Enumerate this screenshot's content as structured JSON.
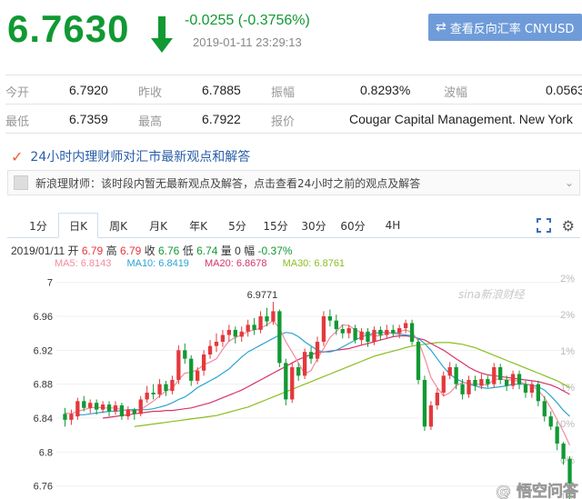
{
  "quote": {
    "price": "6.7630",
    "change": "-0.0255 (-0.3756%)",
    "timestamp": "2019-01-11 23:29:13",
    "reverse_button": "查看反向汇率 CNYUSD",
    "color_down": "#119933"
  },
  "stats": {
    "rows": [
      [
        {
          "label": "今开",
          "value": "6.7920"
        },
        {
          "label": "昨收",
          "value": "6.7885"
        },
        {
          "label": "振幅",
          "value": "0.8293%"
        },
        {
          "label": "波幅",
          "value": "0.0563"
        }
      ],
      [
        {
          "label": "最低",
          "value": "6.7359"
        },
        {
          "label": "最高",
          "value": "6.7922"
        },
        {
          "label": "报价",
          "value": "Cougar Capital Management. New York"
        }
      ]
    ]
  },
  "advice": {
    "title": "24小时内理财师对汇市最新观点和解答",
    "text": "新浪理财师：该时段内暂无最新观点及解答，点击查看24小时之前的观点及解答",
    "more": "⌄"
  },
  "tabs": [
    {
      "label": "1分",
      "active": false
    },
    {
      "label": "日K",
      "active": true
    },
    {
      "label": "周K",
      "active": false
    },
    {
      "label": "月K",
      "active": false
    },
    {
      "label": "年K",
      "active": false
    },
    {
      "label": "5分",
      "active": false
    },
    {
      "label": "15分",
      "active": false
    },
    {
      "label": "30分",
      "active": false
    },
    {
      "label": "60分",
      "active": false
    },
    {
      "label": "4H",
      "active": false
    }
  ],
  "chart_info": {
    "date": "2019/01/11",
    "open_label": "开",
    "open": "6.79",
    "high_label": "高",
    "high": "6.79",
    "close_label": "收",
    "close": "6.76",
    "low_label": "低",
    "low": "6.74",
    "vol_label": "量",
    "vol": "0",
    "amp_label": "幅",
    "amp": "-0.37%"
  },
  "ma": [
    {
      "label": "MA5: 6.8143",
      "color": "#f28b9e"
    },
    {
      "label": "MA10: 6.8419",
      "color": "#2aa4d4"
    },
    {
      "label": "MA20: 6.8678",
      "color": "#d6346a"
    },
    {
      "label": "MA30: 6.8761",
      "color": "#8bbd20"
    }
  ],
  "chart_data": {
    "type": "candlestick",
    "y_ticks": [
      "7",
      "6.96",
      "6.92",
      "6.88",
      "6.84",
      "6.8",
      "6.76"
    ],
    "ylim": [
      6.75,
      7.005
    ],
    "right_ticks": [
      "2%",
      "2%",
      "1%",
      "1%",
      "0%",
      "0%",
      "-1%"
    ],
    "max_label": "6.9771",
    "watermark": "sina新浪财经",
    "corner_watermark": "@ 悟空问答",
    "up_color": "#e4393c",
    "down_color": "#119933",
    "candles": [
      [
        6.845,
        6.838,
        6.852,
        6.83
      ],
      [
        6.838,
        6.845,
        6.85,
        6.832
      ],
      [
        6.842,
        6.86,
        6.864,
        6.838
      ],
      [
        6.86,
        6.852,
        6.866,
        6.848
      ],
      [
        6.852,
        6.858,
        6.862,
        6.846
      ],
      [
        6.858,
        6.85,
        6.862,
        6.844
      ],
      [
        6.85,
        6.856,
        6.86,
        6.846
      ],
      [
        6.856,
        6.848,
        6.86,
        6.842
      ],
      [
        6.848,
        6.855,
        6.86,
        6.844
      ],
      [
        6.855,
        6.842,
        6.858,
        6.838
      ],
      [
        6.842,
        6.85,
        6.854,
        6.838
      ],
      [
        6.85,
        6.845,
        6.852,
        6.838
      ],
      [
        6.845,
        6.862,
        6.866,
        6.842
      ],
      [
        6.862,
        6.87,
        6.878,
        6.858
      ],
      [
        6.87,
        6.868,
        6.88,
        6.862
      ],
      [
        6.868,
        6.88,
        6.886,
        6.864
      ],
      [
        6.88,
        6.872,
        6.884,
        6.866
      ],
      [
        6.872,
        6.885,
        6.89,
        6.868
      ],
      [
        6.885,
        6.92,
        6.926,
        6.88
      ],
      [
        6.92,
        6.91,
        6.928,
        6.904
      ],
      [
        6.91,
        6.884,
        6.914,
        6.878
      ],
      [
        6.884,
        6.896,
        6.9,
        6.88
      ],
      [
        6.896,
        6.915,
        6.92,
        6.89
      ],
      [
        6.915,
        6.925,
        6.932,
        6.91
      ],
      [
        6.925,
        6.93,
        6.94,
        6.918
      ],
      [
        6.93,
        6.938,
        6.944,
        6.924
      ],
      [
        6.938,
        6.944,
        6.95,
        6.93
      ],
      [
        6.944,
        6.936,
        6.948,
        6.928
      ],
      [
        6.936,
        6.942,
        6.948,
        6.93
      ],
      [
        6.942,
        6.95,
        6.956,
        6.936
      ],
      [
        6.95,
        6.944,
        6.958,
        6.938
      ],
      [
        6.944,
        6.96,
        6.966,
        6.94
      ],
      [
        6.96,
        6.954,
        6.97,
        6.948
      ],
      [
        6.954,
        6.966,
        6.977,
        6.95
      ],
      [
        6.966,
        6.905,
        6.968,
        6.9
      ],
      [
        6.905,
        6.862,
        6.91,
        6.855
      ],
      [
        6.862,
        6.9,
        6.906,
        6.858
      ],
      [
        6.9,
        6.89,
        6.905,
        6.884
      ],
      [
        6.89,
        6.918,
        6.922,
        6.886
      ],
      [
        6.918,
        6.91,
        6.924,
        6.904
      ],
      [
        6.91,
        6.93,
        6.936,
        6.906
      ],
      [
        6.93,
        6.96,
        6.966,
        6.925
      ],
      [
        6.96,
        6.955,
        6.968,
        6.948
      ],
      [
        6.955,
        6.945,
        6.962,
        6.938
      ],
      [
        6.945,
        6.94,
        6.95,
        6.934
      ],
      [
        6.94,
        6.946,
        6.95,
        6.934
      ],
      [
        6.946,
        6.932,
        6.95,
        6.928
      ],
      [
        6.932,
        6.942,
        6.946,
        6.926
      ],
      [
        6.942,
        6.93,
        6.946,
        6.924
      ],
      [
        6.93,
        6.944,
        6.948,
        6.926
      ],
      [
        6.944,
        6.938,
        6.948,
        6.932
      ],
      [
        6.938,
        6.944,
        6.95,
        6.934
      ],
      [
        6.944,
        6.94,
        6.95,
        6.936
      ],
      [
        6.94,
        6.946,
        6.95,
        6.934
      ],
      [
        6.946,
        6.952,
        6.956,
        6.94
      ],
      [
        6.952,
        6.93,
        6.956,
        6.926
      ],
      [
        6.93,
        6.885,
        6.934,
        6.88
      ],
      [
        6.885,
        6.83,
        6.89,
        6.825
      ],
      [
        6.83,
        6.855,
        6.86,
        6.826
      ],
      [
        6.855,
        6.87,
        6.875,
        6.85
      ],
      [
        6.87,
        6.89,
        6.895,
        6.866
      ],
      [
        6.89,
        6.9,
        6.906,
        6.886
      ],
      [
        6.9,
        6.88,
        6.904,
        6.874
      ],
      [
        6.88,
        6.868,
        6.886,
        6.862
      ],
      [
        6.868,
        6.885,
        6.89,
        6.864
      ],
      [
        6.885,
        6.878,
        6.89,
        6.872
      ],
      [
        6.878,
        6.886,
        6.892,
        6.874
      ],
      [
        6.886,
        6.88,
        6.89,
        6.876
      ],
      [
        6.88,
        6.9,
        6.905,
        6.876
      ],
      [
        6.9,
        6.885,
        6.904,
        6.88
      ],
      [
        6.885,
        6.878,
        6.89,
        6.872
      ],
      [
        6.878,
        6.892,
        6.896,
        6.874
      ],
      [
        6.892,
        6.88,
        6.896,
        6.874
      ],
      [
        6.88,
        6.87,
        6.884,
        6.864
      ],
      [
        6.87,
        6.88,
        6.884,
        6.864
      ],
      [
        6.88,
        6.86,
        6.884,
        6.854
      ],
      [
        6.86,
        6.842,
        6.866,
        6.836
      ],
      [
        6.842,
        6.83,
        6.848,
        6.826
      ],
      [
        6.83,
        6.81,
        6.836,
        6.802
      ],
      [
        6.81,
        6.792,
        6.812,
        6.785
      ],
      [
        6.792,
        6.763,
        6.795,
        6.742
      ]
    ],
    "ma5": [
      6.846,
      6.845,
      6.848,
      6.85,
      6.852,
      6.853,
      6.852,
      6.852,
      6.852,
      6.85,
      6.849,
      6.848,
      6.85,
      6.855,
      6.86,
      6.866,
      6.872,
      6.875,
      6.885,
      6.893,
      6.894,
      6.897,
      6.903,
      6.906,
      6.91,
      6.921,
      6.931,
      6.935,
      6.938,
      6.942,
      6.944,
      6.946,
      6.95,
      6.955,
      6.946,
      6.93,
      6.918,
      6.905,
      6.892,
      6.896,
      6.91,
      6.922,
      6.935,
      6.942,
      6.95,
      6.949,
      6.944,
      6.941,
      6.938,
      6.937,
      6.937,
      6.94,
      6.94,
      6.942,
      6.944,
      6.941,
      6.931,
      6.911,
      6.888,
      6.876,
      6.866,
      6.87,
      6.878,
      6.882,
      6.881,
      6.88,
      6.88,
      6.879,
      6.886,
      6.886,
      6.885,
      6.885,
      6.883,
      6.88,
      6.878,
      6.873,
      6.864,
      6.852,
      6.838,
      6.824,
      6.808
    ],
    "ma10": [
      6.844,
      6.844,
      6.845,
      6.846,
      6.847,
      6.848,
      6.848,
      6.849,
      6.85,
      6.85,
      6.85,
      6.85,
      6.851,
      6.853,
      6.855,
      6.858,
      6.862,
      6.865,
      6.87,
      6.876,
      6.88,
      6.884,
      6.888,
      6.893,
      6.898,
      6.905,
      6.912,
      6.918,
      6.922,
      6.926,
      6.93,
      6.934,
      6.938,
      6.941,
      6.94,
      6.936,
      6.93,
      6.925,
      6.92,
      6.918,
      6.918,
      6.92,
      6.924,
      6.928,
      6.932,
      6.936,
      6.938,
      6.94,
      6.941,
      6.941,
      6.94,
      6.939,
      6.938,
      6.937,
      6.934,
      6.928,
      6.92,
      6.91,
      6.9,
      6.892,
      6.886,
      6.883,
      6.88,
      6.878,
      6.876,
      6.875,
      6.876,
      6.877,
      6.878,
      6.88,
      6.88,
      6.88,
      6.879,
      6.877,
      6.873,
      6.866,
      6.858,
      6.849,
      6.842
    ],
    "ma20": [
      6.84,
      6.841,
      6.842,
      6.843,
      6.844,
      6.845,
      6.846,
      6.847,
      6.848,
      6.848,
      6.849,
      6.849,
      6.85,
      6.851,
      6.852,
      6.854,
      6.856,
      6.858,
      6.861,
      6.864,
      6.867,
      6.87,
      6.873,
      6.877,
      6.881,
      6.885,
      6.889,
      6.893,
      6.897,
      6.901,
      6.905,
      6.909,
      6.912,
      6.915,
      6.917,
      6.918,
      6.919,
      6.92,
      6.921,
      6.922,
      6.924,
      6.926,
      6.928,
      6.93,
      6.932,
      6.934,
      6.936,
      6.937,
      6.937,
      6.936,
      6.934,
      6.932,
      6.928,
      6.924,
      6.92,
      6.915,
      6.91,
      6.905,
      6.9,
      6.896,
      6.893,
      6.891,
      6.89,
      6.889,
      6.888,
      6.887,
      6.886,
      6.885,
      6.884,
      6.883,
      6.881,
      6.879,
      6.876,
      6.872,
      6.868
    ],
    "ma30": [
      6.83,
      6.831,
      6.832,
      6.833,
      6.834,
      6.835,
      6.836,
      6.837,
      6.838,
      6.839,
      6.84,
      6.841,
      6.842,
      6.843,
      6.845,
      6.847,
      6.849,
      6.851,
      6.853,
      6.856,
      6.859,
      6.862,
      6.865,
      6.868,
      6.871,
      6.874,
      6.877,
      6.88,
      6.883,
      6.886,
      6.889,
      6.892,
      6.895,
      6.898,
      6.901,
      6.904,
      6.907,
      6.91,
      6.913,
      6.915,
      6.917,
      6.919,
      6.921,
      6.923,
      6.925,
      6.926,
      6.927,
      6.928,
      6.929,
      6.929,
      6.929,
      6.928,
      6.927,
      6.925,
      6.923,
      6.92,
      6.917,
      6.914,
      6.911,
      6.908,
      6.905,
      6.902,
      6.899,
      6.896,
      6.893,
      6.89,
      6.887,
      6.884,
      6.88,
      6.876
    ]
  }
}
